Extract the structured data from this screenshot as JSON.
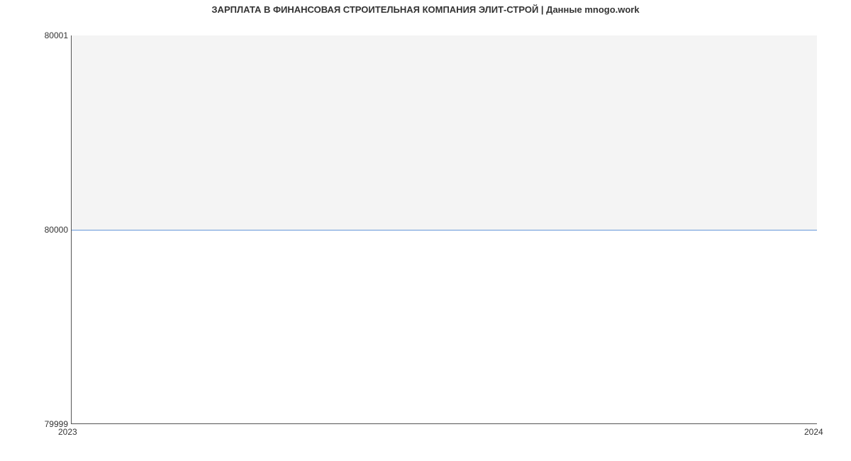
{
  "chart_data": {
    "type": "line",
    "title": "ЗАРПЛАТА В  ФИНАНСОВАЯ СТРОИТЕЛЬНАЯ КОМПАНИЯ ЭЛИТ-СТРОЙ | Данные mnogo.work",
    "xlabel": "",
    "ylabel": "",
    "x": [
      "2023",
      "2024"
    ],
    "values": [
      80000,
      80000
    ],
    "ylim": [
      79999,
      80001
    ],
    "y_ticks": [
      "80001",
      "80000",
      "79999"
    ],
    "x_ticks": [
      "2023",
      "2024"
    ],
    "line_color": "#6698d8"
  }
}
